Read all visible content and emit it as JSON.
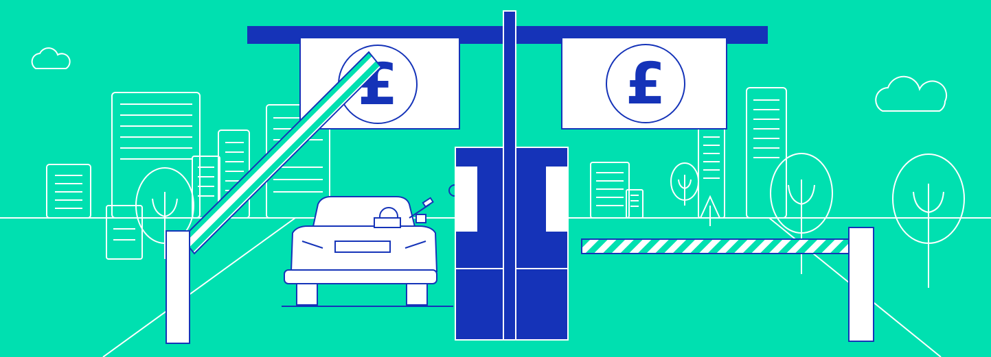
{
  "colors": {
    "background": "#00E0B0",
    "outline": "#FFFFFF",
    "navy": "#1533B8",
    "stripe": "#00E0B0"
  },
  "toll_signs": {
    "left_symbol": "£",
    "right_symbol": "£"
  },
  "scene": {
    "illustration": "toll-plaza",
    "left_barrier_state": "raised",
    "right_barrier_state": "lowered",
    "icons": [
      "cloud-icon",
      "building-icon",
      "tree-icon",
      "car-icon",
      "toll-booth-icon",
      "barrier-icon",
      "pound-sign-icon"
    ]
  }
}
